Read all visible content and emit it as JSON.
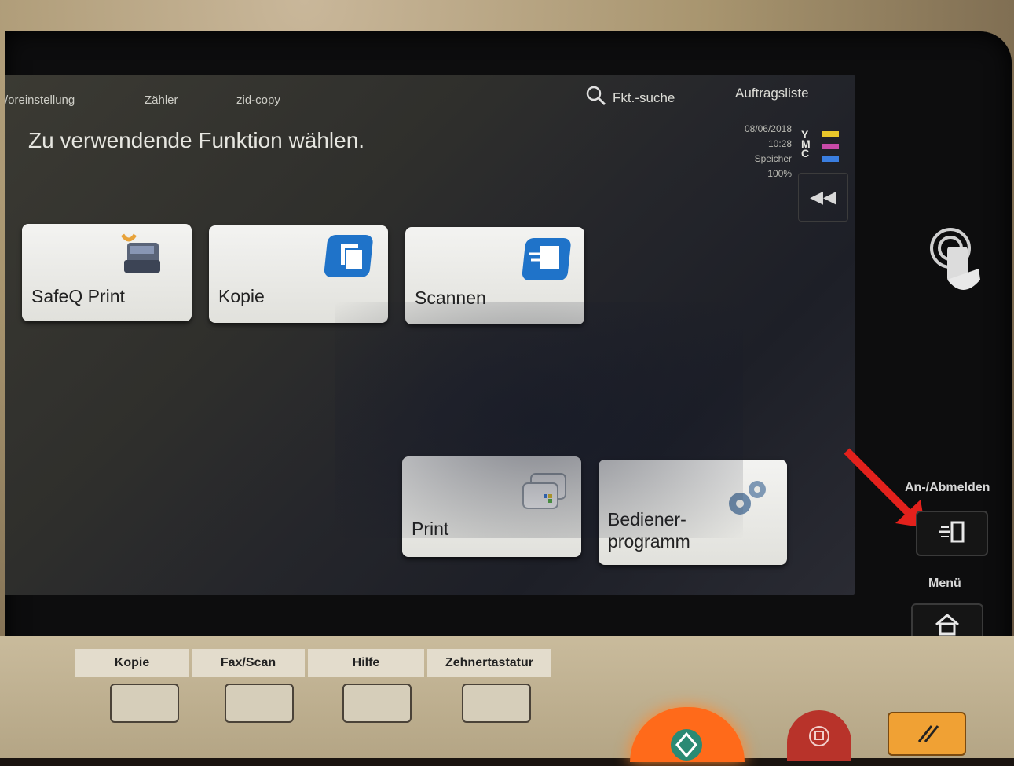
{
  "topnav": {
    "preset": "/oreinstellung",
    "counter": "Zähler",
    "zid": "zid-copy",
    "search": "Fkt.-suche",
    "joblist": "Auftragsliste"
  },
  "title": "Zu verwendende Funktion wählen.",
  "status": {
    "date": "08/06/2018",
    "time": "10:28",
    "memory_label": "Speicher",
    "memory_value": "100%"
  },
  "toner": {
    "letters": [
      "Y",
      "M",
      "C"
    ],
    "colors": [
      "#e8c62a",
      "#c84aa8",
      "#3a7ee0"
    ]
  },
  "tiles": {
    "safeq": "SafeQ Print",
    "kopie": "Kopie",
    "scannen": "Scannen",
    "print": "Print",
    "bediener_line1": "Bediener-",
    "bediener_line2": "programm"
  },
  "side": {
    "login_label": "An-/Abmelden",
    "menu_label": "Menü"
  },
  "hardware": {
    "tabs": [
      "Kopie",
      "Fax/Scan",
      "Hilfe",
      "Zehnertastatur"
    ]
  },
  "accent": {
    "tile_icon": "#1f73c9",
    "arrow": "#e3211c"
  }
}
